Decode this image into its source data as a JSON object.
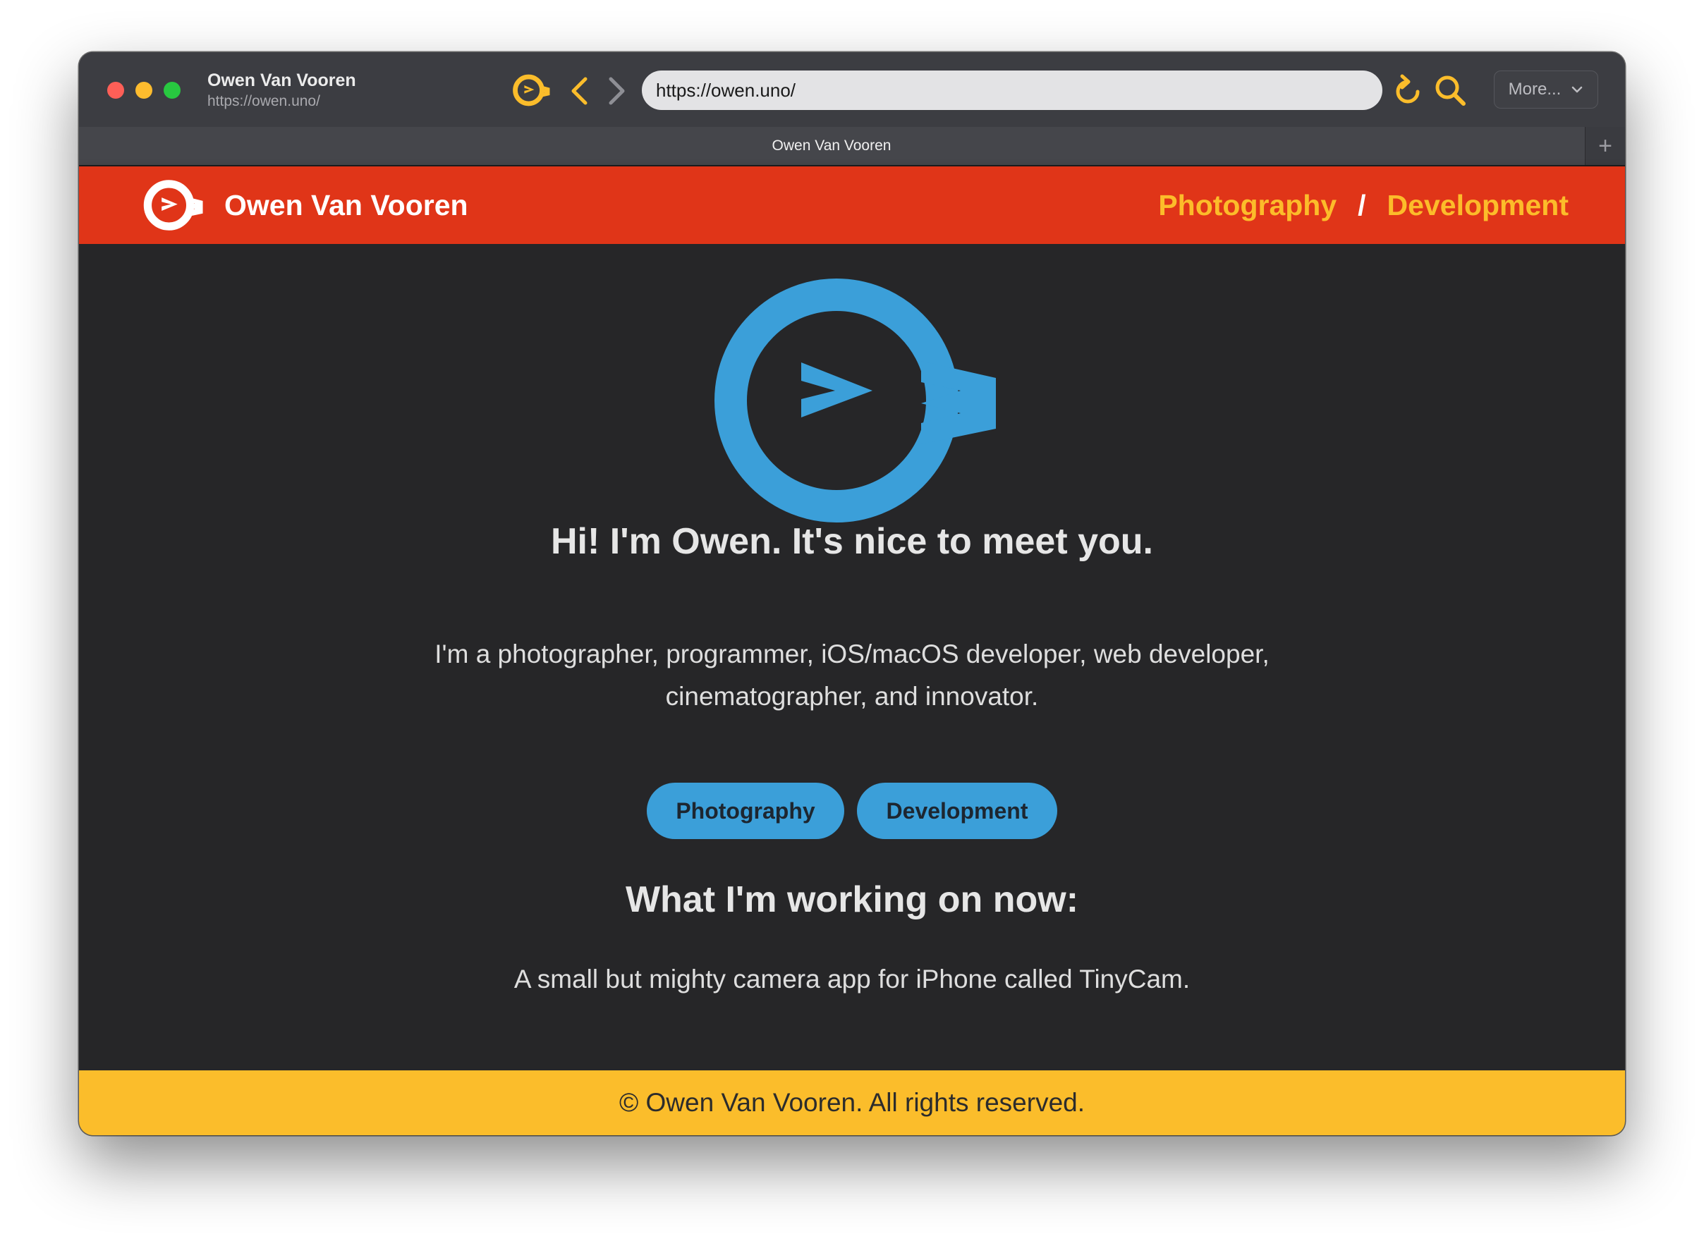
{
  "window": {
    "title": "Owen Van Vooren",
    "url": "https://owen.uno/"
  },
  "toolbar": {
    "address": "https://owen.uno/",
    "more_label": "More...",
    "icons": [
      "site-logo-icon",
      "back-icon",
      "forward-icon",
      "reload-icon",
      "search-icon",
      "chevron-down-icon"
    ],
    "accent_color": "#fbbd2b"
  },
  "tab": {
    "title": "Owen Van Vooren",
    "new_tab_label": "+"
  },
  "header": {
    "site_name": "Owen Van Vooren",
    "nav": [
      "Photography",
      "Development"
    ],
    "separator": "/",
    "background_color": "#e03518",
    "nav_color": "#fcbc2a"
  },
  "main": {
    "greeting": "Hi! I'm Owen. It's nice to meet you.",
    "intro": "I'm a photographer, programmer, iOS/macOS developer, web developer, cinematographer, and innovator.",
    "buttons": [
      "Photography",
      "Development"
    ],
    "working_heading": "What I'm working on now:",
    "working_text": "A small but mighty camera app for iPhone called TinyCam.",
    "logo_color": "#3b9fd9"
  },
  "footer": {
    "text": "© Owen Van Vooren. All rights reserved.",
    "background_color": "#fbbd2b"
  }
}
